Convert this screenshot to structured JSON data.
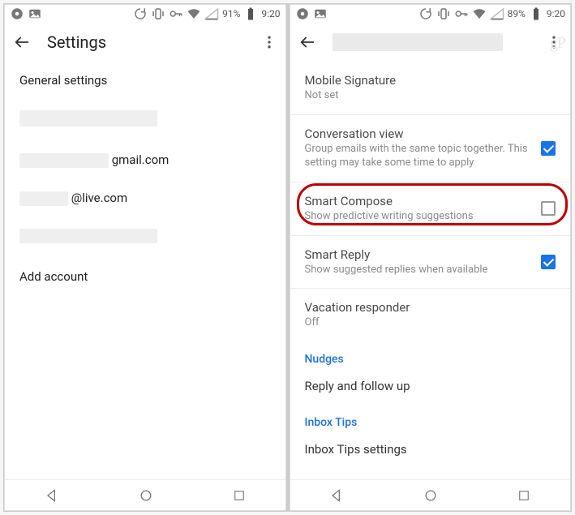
{
  "left": {
    "status": {
      "battery": "91%",
      "time": "9:20"
    },
    "appbar": {
      "title": "Settings"
    },
    "general_label": "General settings",
    "accounts": {
      "gmail_suffix": "gmail.com",
      "live_suffix": "@live.com"
    },
    "add_account": "Add account"
  },
  "right": {
    "status": {
      "battery": "89%",
      "time": "9:20"
    },
    "settings": {
      "mobile_signature": {
        "title": "Mobile Signature",
        "sub": "Not set"
      },
      "conversation_view": {
        "title": "Conversation view",
        "sub": "Group emails with the same topic together. This setting may take some time to apply",
        "checked": true
      },
      "smart_compose": {
        "title": "Smart Compose",
        "sub": "Show predictive writing suggestions",
        "checked": false
      },
      "smart_reply": {
        "title": "Smart Reply",
        "sub": "Show suggested replies when available",
        "checked": true
      },
      "vacation": {
        "title": "Vacation responder",
        "sub": "Off"
      }
    },
    "sections": {
      "nudges_label": "Nudges",
      "nudges_item": "Reply and follow up",
      "inbox_tips_label": "Inbox Tips",
      "inbox_tips_item": "Inbox Tips settings"
    },
    "watermark": "gP"
  }
}
